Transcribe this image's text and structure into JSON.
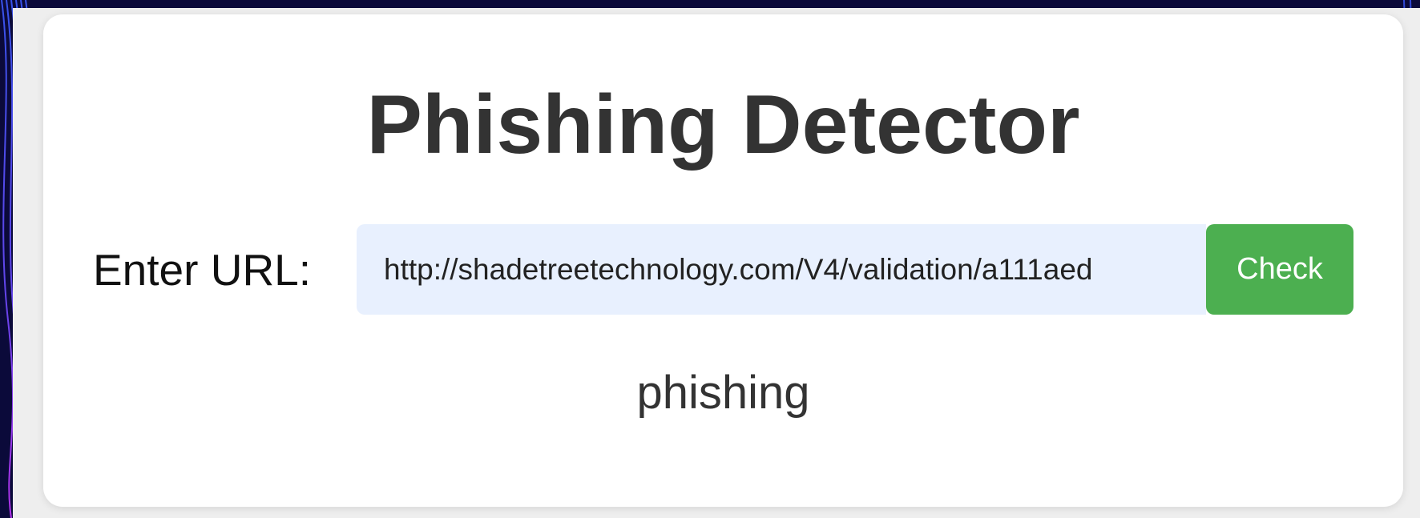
{
  "header": {
    "title": "Phishing Detector"
  },
  "form": {
    "label": "Enter URL:",
    "url_value": "http://shadetreetechnology.com/V4/validation/a111aed",
    "check_label": "Check"
  },
  "result": {
    "text": "phishing"
  },
  "colors": {
    "background_dark": "#0b0a3a",
    "card": "#ffffff",
    "input_background": "#e8f0fe",
    "button": "#4caf50",
    "title_text": "#333333"
  }
}
